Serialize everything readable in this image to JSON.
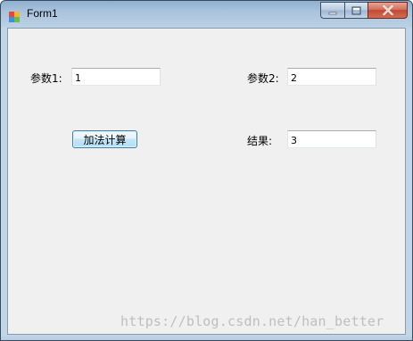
{
  "window": {
    "title": "Form1",
    "icon": "winforms-app-icon",
    "controls": {
      "minimize_icon": "minimize-icon",
      "maximize_icon": "maximize-icon",
      "close_icon": "close-icon"
    }
  },
  "form": {
    "param1_label": "参数1:",
    "param1_value": "1",
    "param2_label": "参数2:",
    "param2_value": "2",
    "add_button_label": "加法计算",
    "result_label": "结果:",
    "result_value": "3"
  },
  "watermark": "https://blog.csdn.net/han_better",
  "colors": {
    "titlebar": "#b9cfe3",
    "client_bg": "#f0f0f0",
    "close_button": "#c24a35",
    "button_border": "#3c7fb1"
  }
}
